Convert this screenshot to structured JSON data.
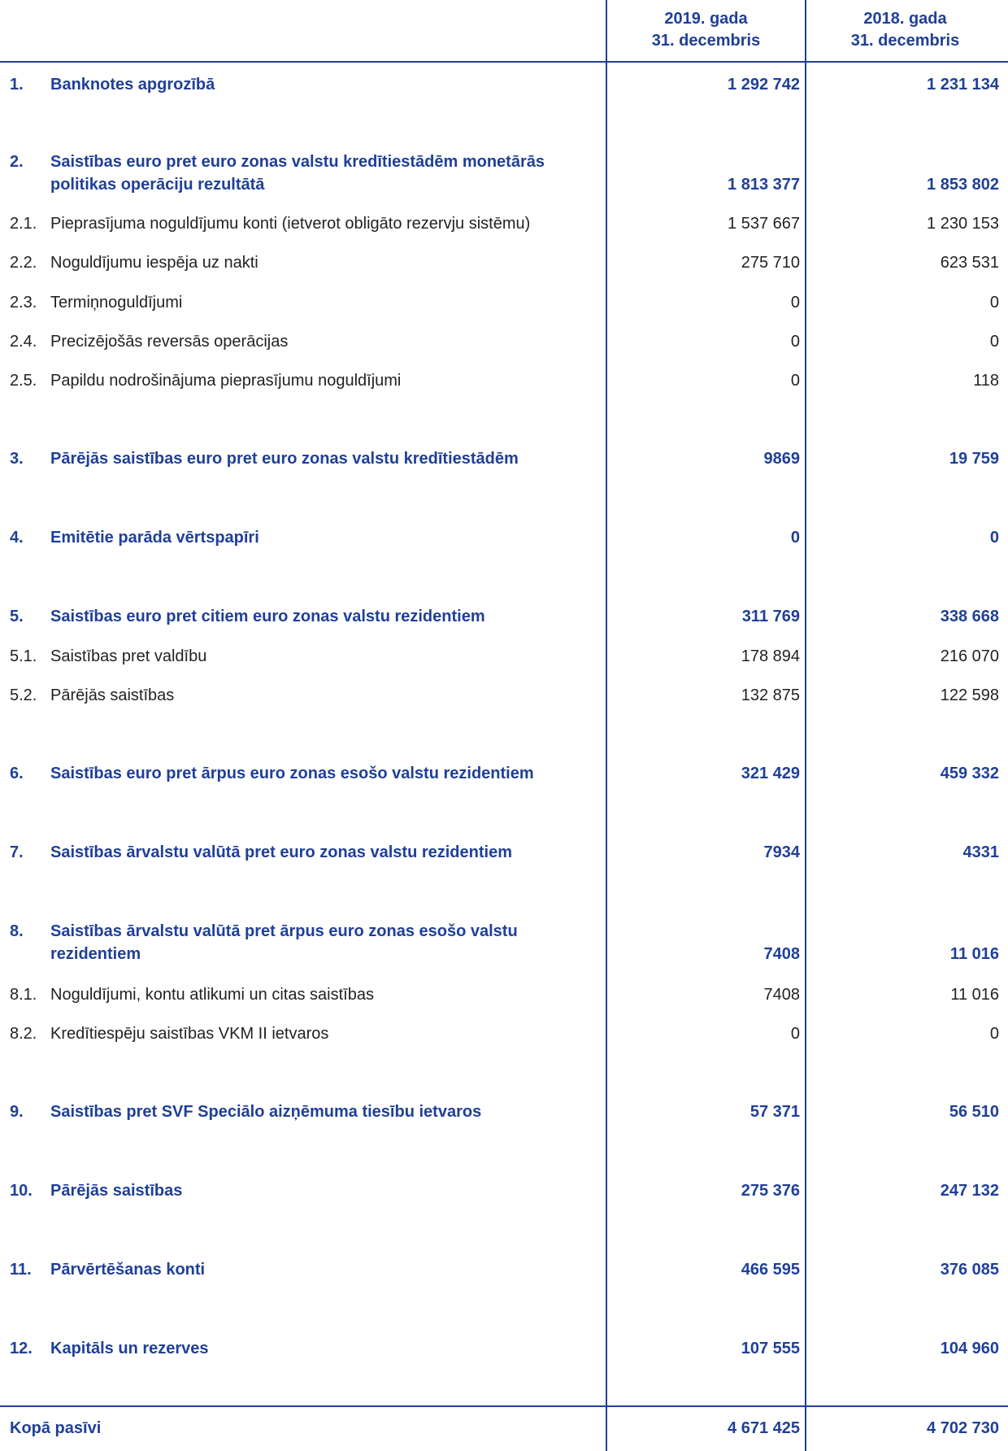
{
  "header": {
    "col1_line1": "2019. gada",
    "col1_line2": "31. decembris",
    "col2_line1": "2018. gada",
    "col2_line2": "31. decembris"
  },
  "rows": [
    {
      "num": "1.",
      "label": "Banknotes apgrozībā",
      "v2019": "1 292 742",
      "v2018": "1 231 134"
    },
    {
      "num": "2.",
      "label": "Saistības euro pret euro zonas valstu kredītiestādēm monetārās politikas operāciju rezultātā",
      "v2019": "1 813 377",
      "v2018": "1 853 802"
    },
    {
      "num": "2.1.",
      "label": "Pieprasījuma noguldījumu konti (ietverot obligāto rezervju sistēmu)",
      "v2019": "1 537 667",
      "v2018": "1 230 153"
    },
    {
      "num": "2.2.",
      "label": "Noguldījumu iespēja uz nakti",
      "v2019": "275 710",
      "v2018": "623 531"
    },
    {
      "num": "2.3.",
      "label": "Termiņnoguldījumi",
      "v2019": "0",
      "v2018": "0"
    },
    {
      "num": "2.4.",
      "label": "Precizējošās reversās operācijas",
      "v2019": "0",
      "v2018": "0"
    },
    {
      "num": "2.5.",
      "label": "Papildu nodrošinājuma pieprasījumu noguldījumi",
      "v2019": "0",
      "v2018": "118"
    },
    {
      "num": "3.",
      "label": "Pārējās saistības euro pret euro zonas valstu kredītiestādēm",
      "v2019": "9869",
      "v2018": "19 759"
    },
    {
      "num": "4.",
      "label": "Emitētie parāda vērtspapīri",
      "v2019": "0",
      "v2018": "0"
    },
    {
      "num": "5.",
      "label": "Saistības euro pret citiem euro zonas valstu rezidentiem",
      "v2019": "311 769",
      "v2018": "338 668"
    },
    {
      "num": "5.1.",
      "label": "Saistības pret valdību",
      "v2019": "178 894",
      "v2018": "216 070"
    },
    {
      "num": "5.2.",
      "label": "Pārējās saistības",
      "v2019": "132 875",
      "v2018": "122 598"
    },
    {
      "num": "6.",
      "label": "Saistības euro pret ārpus euro zonas esošo valstu rezidentiem",
      "v2019": "321 429",
      "v2018": "459 332"
    },
    {
      "num": "7.",
      "label": "Saistības ārvalstu valūtā pret euro zonas valstu rezidentiem",
      "v2019": "7934",
      "v2018": "4331"
    },
    {
      "num": "8.",
      "label": "Saistības ārvalstu valūtā pret ārpus euro zonas esošo valstu rezidentiem",
      "v2019": "7408",
      "v2018": "11 016"
    },
    {
      "num": "8.1.",
      "label": "Noguldījumi, kontu atlikumi un citas saistības",
      "v2019": "7408",
      "v2018": "11 016"
    },
    {
      "num": "8.2.",
      "label": "Kredītiespēju saistības VKM II ietvaros",
      "v2019": "0",
      "v2018": "0"
    },
    {
      "num": "9.",
      "label": "Saistības pret SVF Speciālo aizņēmuma tiesību ietvaros",
      "v2019": "57 371",
      "v2018": "56 510"
    },
    {
      "num": "10.",
      "label": "Pārējās saistības",
      "v2019": "275 376",
      "v2018": "247 132"
    },
    {
      "num": "11.",
      "label": "Pārvērtēšanas konti",
      "v2019": "466 595",
      "v2018": "376 085"
    },
    {
      "num": "12.",
      "label": "Kapitāls un rezerves",
      "v2019": "107 555",
      "v2018": "104 960"
    }
  ],
  "total": {
    "label": "Kopā pasīvi",
    "v2019": "4 671 425",
    "v2018": "4 702 730"
  }
}
